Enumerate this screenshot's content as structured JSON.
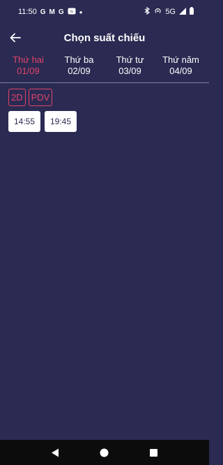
{
  "status_bar": {
    "time": "11:50",
    "left_icons": [
      "G",
      "M",
      "G",
      "tv"
    ],
    "network": "5G"
  },
  "header": {
    "title": "Chọn suất chiếu"
  },
  "date_tabs": [
    {
      "day": "Thứ hai",
      "date": "01/09",
      "active": true
    },
    {
      "day": "Thứ ba",
      "date": "02/09",
      "active": false
    },
    {
      "day": "Thứ tư",
      "date": "03/09",
      "active": false
    },
    {
      "day": "Thứ năm",
      "date": "04/09",
      "active": false
    }
  ],
  "formats": [
    "2D",
    "PDV"
  ],
  "showtimes": [
    "14:55",
    "19:45"
  ],
  "colors": {
    "background": "#2b2a52",
    "accent": "#e0446b",
    "nav_bar": "#0c0c0c"
  }
}
